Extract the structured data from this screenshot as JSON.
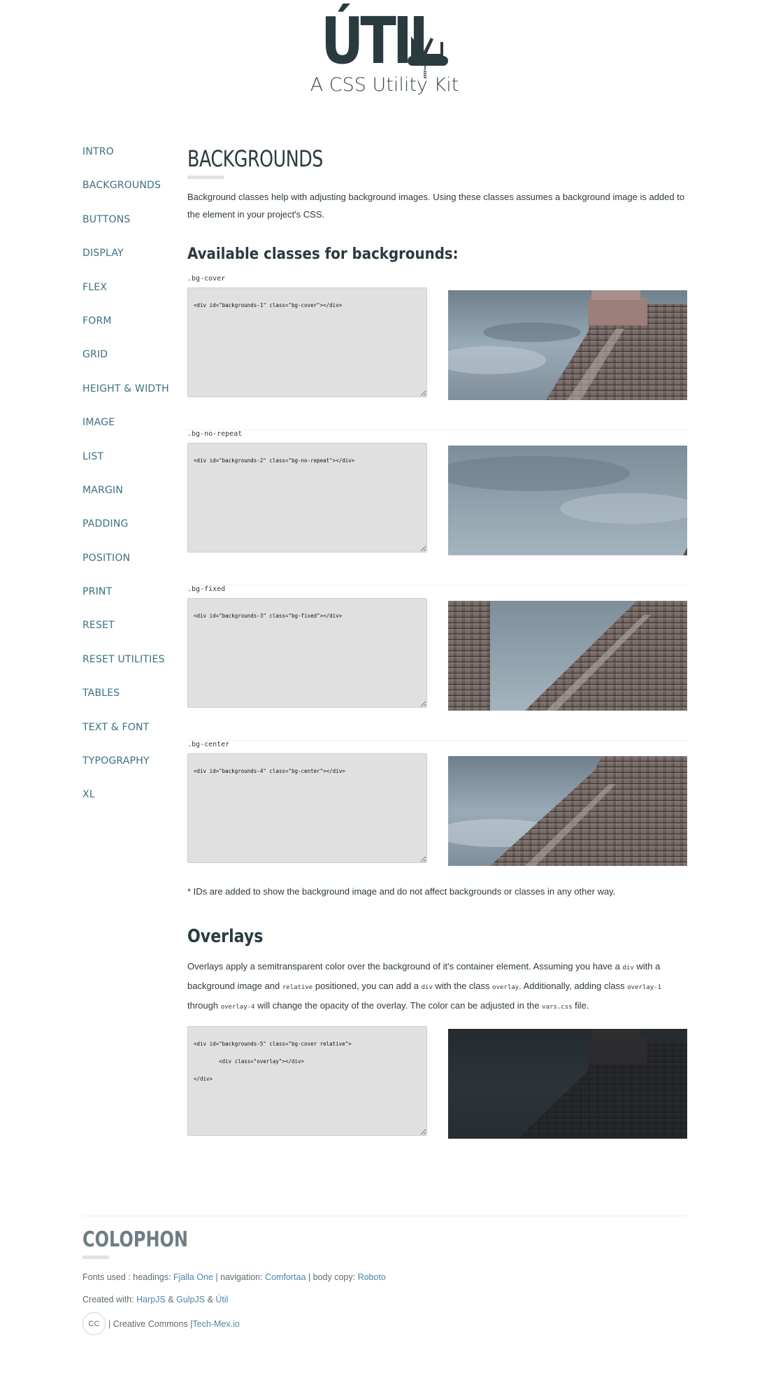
{
  "header": {
    "logo_text": "ÚTIL",
    "tagline": "A CSS Utility Kit"
  },
  "nav": {
    "items": [
      "INTRO",
      "BACKGROUNDS",
      "BUTTONS",
      "DISPLAY",
      "FLEX",
      "FORM",
      "GRID",
      "HEIGHT & WIDTH",
      "IMAGE",
      "LIST",
      "MARGIN",
      "PADDING",
      "POSITION",
      "PRINT",
      "RESET",
      "RESET UTILITIES",
      "TABLES",
      "TEXT & FONT",
      "TYPOGRAPHY",
      "XL"
    ]
  },
  "main": {
    "title": "BACKGROUNDS",
    "lead": "Background classes help with adjusting background images. Using these classes assumes a background image is added to the element in your project's CSS.",
    "available_heading": "Available classes for backgrounds:",
    "examples": [
      {
        "label": ".bg-cover",
        "code": "<div id=\"backgrounds-1\" class=\"bg-cover\"></div>"
      },
      {
        "label": ".bg-no-repeat",
        "code": "<div id=\"backgrounds-2\" class=\"bg-no-repeat\"></div>"
      },
      {
        "label": ".bg-fixed",
        "code": "<div id=\"backgrounds-3\" class=\"bg-fixed\"></div>"
      },
      {
        "label": ".bg-center",
        "code": "<div id=\"backgrounds-4\" class=\"bg-center\"></div>"
      }
    ],
    "note": "* IDs are added to show the background image and do not affect backgrounds or classes in any other way.",
    "overlays": {
      "title": "Overlays",
      "p1": "Overlays apply a semitransparent color over the background of it's container element. Assuming you have a ",
      "c1": "div",
      "p2": " with a background image and ",
      "c2": "relative",
      "p3": " positioned, you can add a ",
      "c3": "div",
      "p4": " with the class ",
      "c4": "overlay",
      "p5": ". Additionally, adding class ",
      "c5": "overlay-1",
      "p6": " through ",
      "c6": "overlay-4",
      "p7": " will change the opacity of the overlay. The color can be adjusted in the ",
      "c7": "vars.css",
      "p8": " file.",
      "code": "<div id=\"backgrounds-5\" class=\"bg-cover relative\">\n        <div class=\"overlay\"></div>\n</div>"
    }
  },
  "footer": {
    "title": "COLOPHON",
    "fonts_prefix": "Fonts used : headings: ",
    "font_headings": "Fjalla One",
    "fonts_nav_sep": " | navigation: ",
    "font_nav": "Comfortaa",
    "fonts_body_sep": " | body copy: ",
    "font_body": "Roboto",
    "created_prefix": "Created with: ",
    "created_1": "HarpJS",
    "amp": " & ",
    "created_2": "GulpJS",
    "created_3": "Útil",
    "cc_badge": "CC",
    "cc_text": " | Creative Commons | ",
    "cc_link": "Tech-Mex.io"
  },
  "colors": {
    "nav_link": "#3b7083",
    "footer_link": "#4a88a8",
    "heading": "#2a3b40",
    "code_bg": "#e0e0e0"
  }
}
